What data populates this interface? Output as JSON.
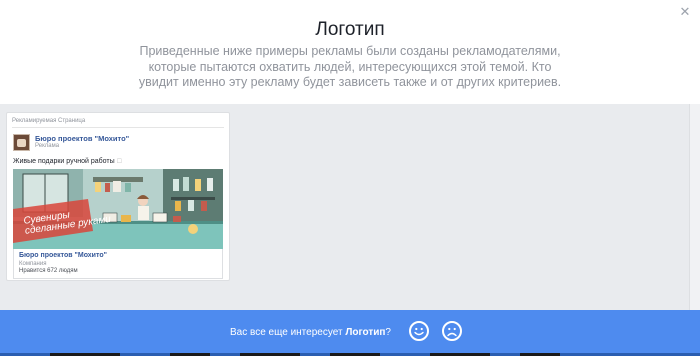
{
  "dialog": {
    "title": "Логотип",
    "subtitle": "Приведенные ниже примеры рекламы были созданы рекламодателями, которые пытаются охватить людей, интересующихся этой темой. Кто увидит именно эту рекламу будет зависеть также и от других критериев.",
    "close_icon": "✕"
  },
  "ad": {
    "top_label": "Рекламируемая Страница",
    "page_name": "Бюро проектов \"Мохито\"",
    "sponsored": "Реклама",
    "text": "Живые подарки ручной работы",
    "text_mark": "☐",
    "banner_line1": "Сувениры",
    "banner_line2": "сделанные руками",
    "caption_name": "Бюро проектов \"Мохито\"",
    "caption_category": "Компания",
    "caption_likes": "Нравится 672 людям"
  },
  "footer": {
    "question_prefix": "Вас все еще интересует ",
    "question_topic": "Логотип",
    "question_suffix": "?",
    "happy_icon": "smile-icon",
    "sad_icon": "frown-icon",
    "accent_color": "#4e8bef"
  }
}
